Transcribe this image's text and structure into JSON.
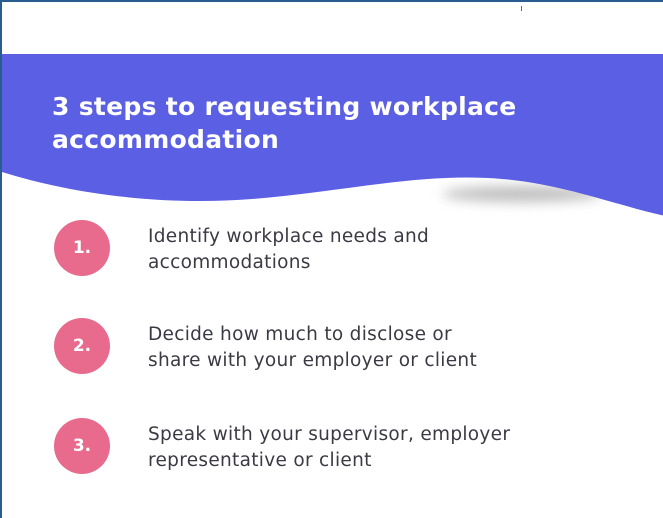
{
  "colors": {
    "banner": "#5b5fe3",
    "badge": "#e86b8e",
    "text": "#3a3a44",
    "frame_border": "#2a5d8f"
  },
  "header": {
    "title_line1": "3 steps to requesting workplace",
    "title_line2": "accommodation"
  },
  "steps": [
    {
      "number": "1.",
      "line1": "Identify workplace needs and",
      "line2": "accommodations"
    },
    {
      "number": "2.",
      "line1": "Decide how much to disclose or",
      "line2": "share with your employer or client"
    },
    {
      "number": "3.",
      "line1": "Speak with your supervisor, employer",
      "line2": "representative or client"
    }
  ]
}
